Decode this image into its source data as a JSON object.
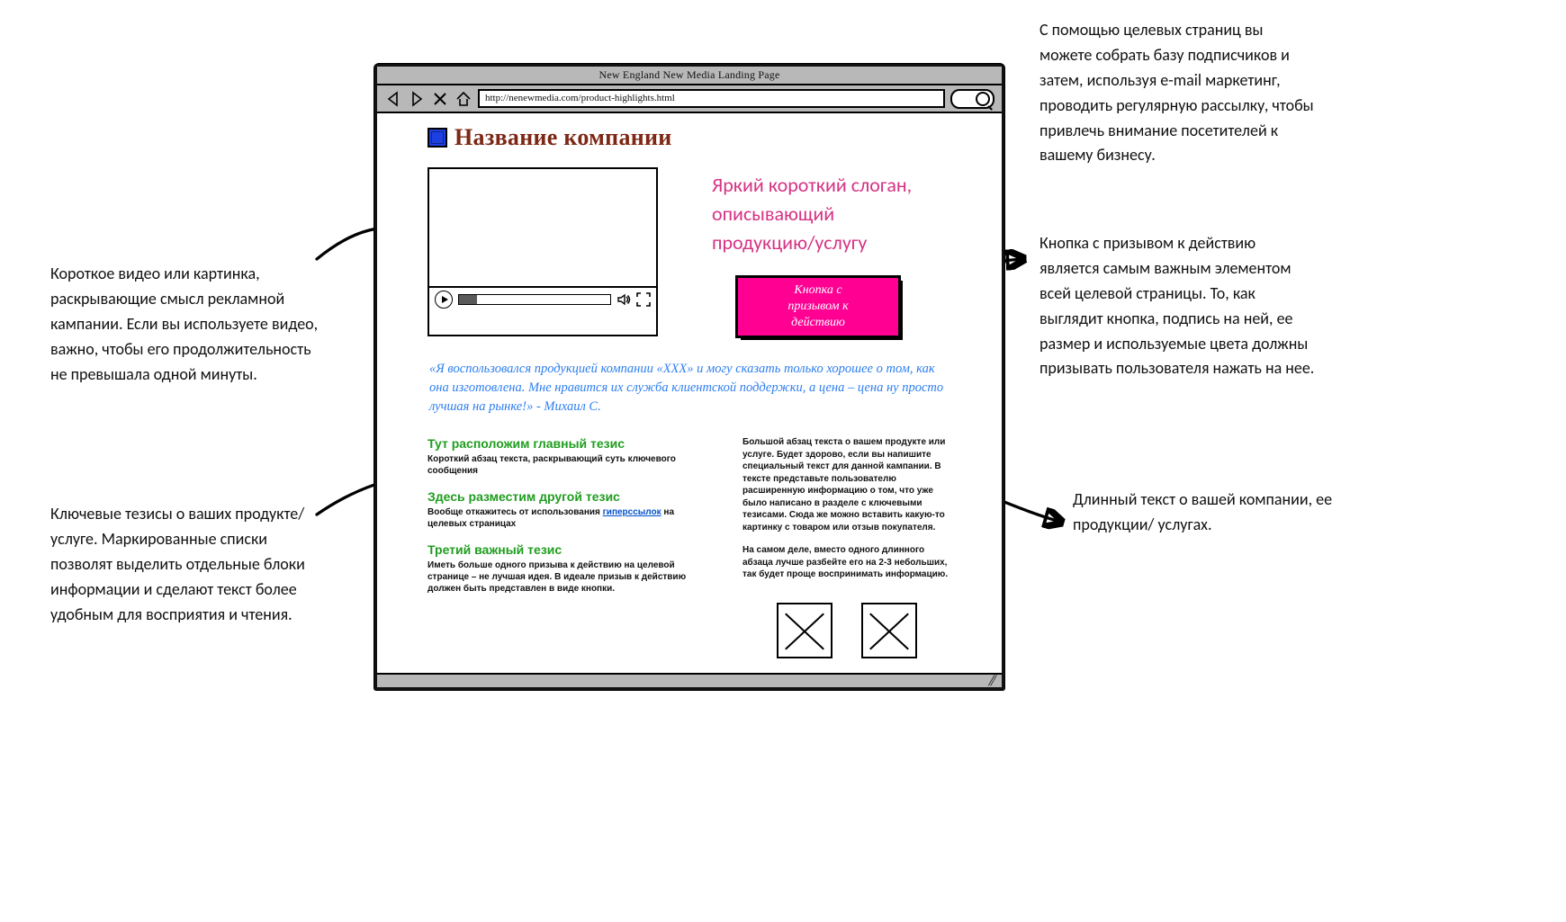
{
  "browser": {
    "title": "New England New Media Landing Page",
    "url": "http://nenewmedia.com/product-highlights.html"
  },
  "page": {
    "company_name": "Название компании",
    "slogan": "Яркий короткий слоган, описывающий продукцию/услугу",
    "cta_line1": "Кнопка с",
    "cta_line2": "призывом к действию",
    "quote": "«Я воспользовался продукцией компании «XXX» и могу сказать только хорошее о том, как она изготовлена. Мне нравится их служба клиентской поддержки, а цена – цена ну просто лучшая на рынке!» - Михаил С.",
    "thesis1_title": "Тут расположим главный тезис",
    "thesis1_body": "Короткий абзац текста, раскрывающий суть ключевого сообщения",
    "thesis2_title": "Здесь разместим другой тезис",
    "thesis2_body_before": "Вообще откажитесь от использования ",
    "thesis2_link": "гиперссылок",
    "thesis2_body_after": " на целевых страницах",
    "thesis3_title": "Третий важный тезис",
    "thesis3_body": "Иметь больше одного призыва к действию на целевой странице – не лучшая идея. В идеале призыв к действию должен быть представлен в виде кнопки.",
    "long_para1": "Большой абзац текста о вашем продукте или услуге. Будет здорово, если вы напишите специальный текст для данной кампании. В тексте представьте пользователю расширенную информацию о том, что уже было написано в разделе с ключевыми тезисами. Сюда же можно вставить какую-то картинку с товаром или отзыв покупателя.",
    "long_para2": "На самом деле, вместо одного длинного абзаца лучше разбейте его на 2-3 небольших, так будет проще воспринимать информацию."
  },
  "annotations": {
    "subscribe": "С помощью целевых страниц вы можете собрать базу подписчиков и затем, используя e-mail маркетинг, проводить регулярную рассылку, чтобы привлечь внимание посетителей к вашему бизнесу.",
    "video": "Короткое видео или картинка, раскрывающие смысл рекламной кампании. Если вы используете видео, важно, чтобы его продолжительность не превышала одной минуты.",
    "cta": "Кнопка с призывом к действию является самым важным элементом всей целевой страницы. То, как выглядит кнопка, подпись на ней, ее размер и используемые цвета должны призывать пользователя нажать на нее.",
    "theses": "Ключевые тезисы о ваших продукте/услуге. Маркированные списки позволят выделить отдельные блоки информации и сделают текст более удобным для восприятия и чтения.",
    "longtext": "Длинный текст о вашей компании, ее продукции/ услугах."
  }
}
